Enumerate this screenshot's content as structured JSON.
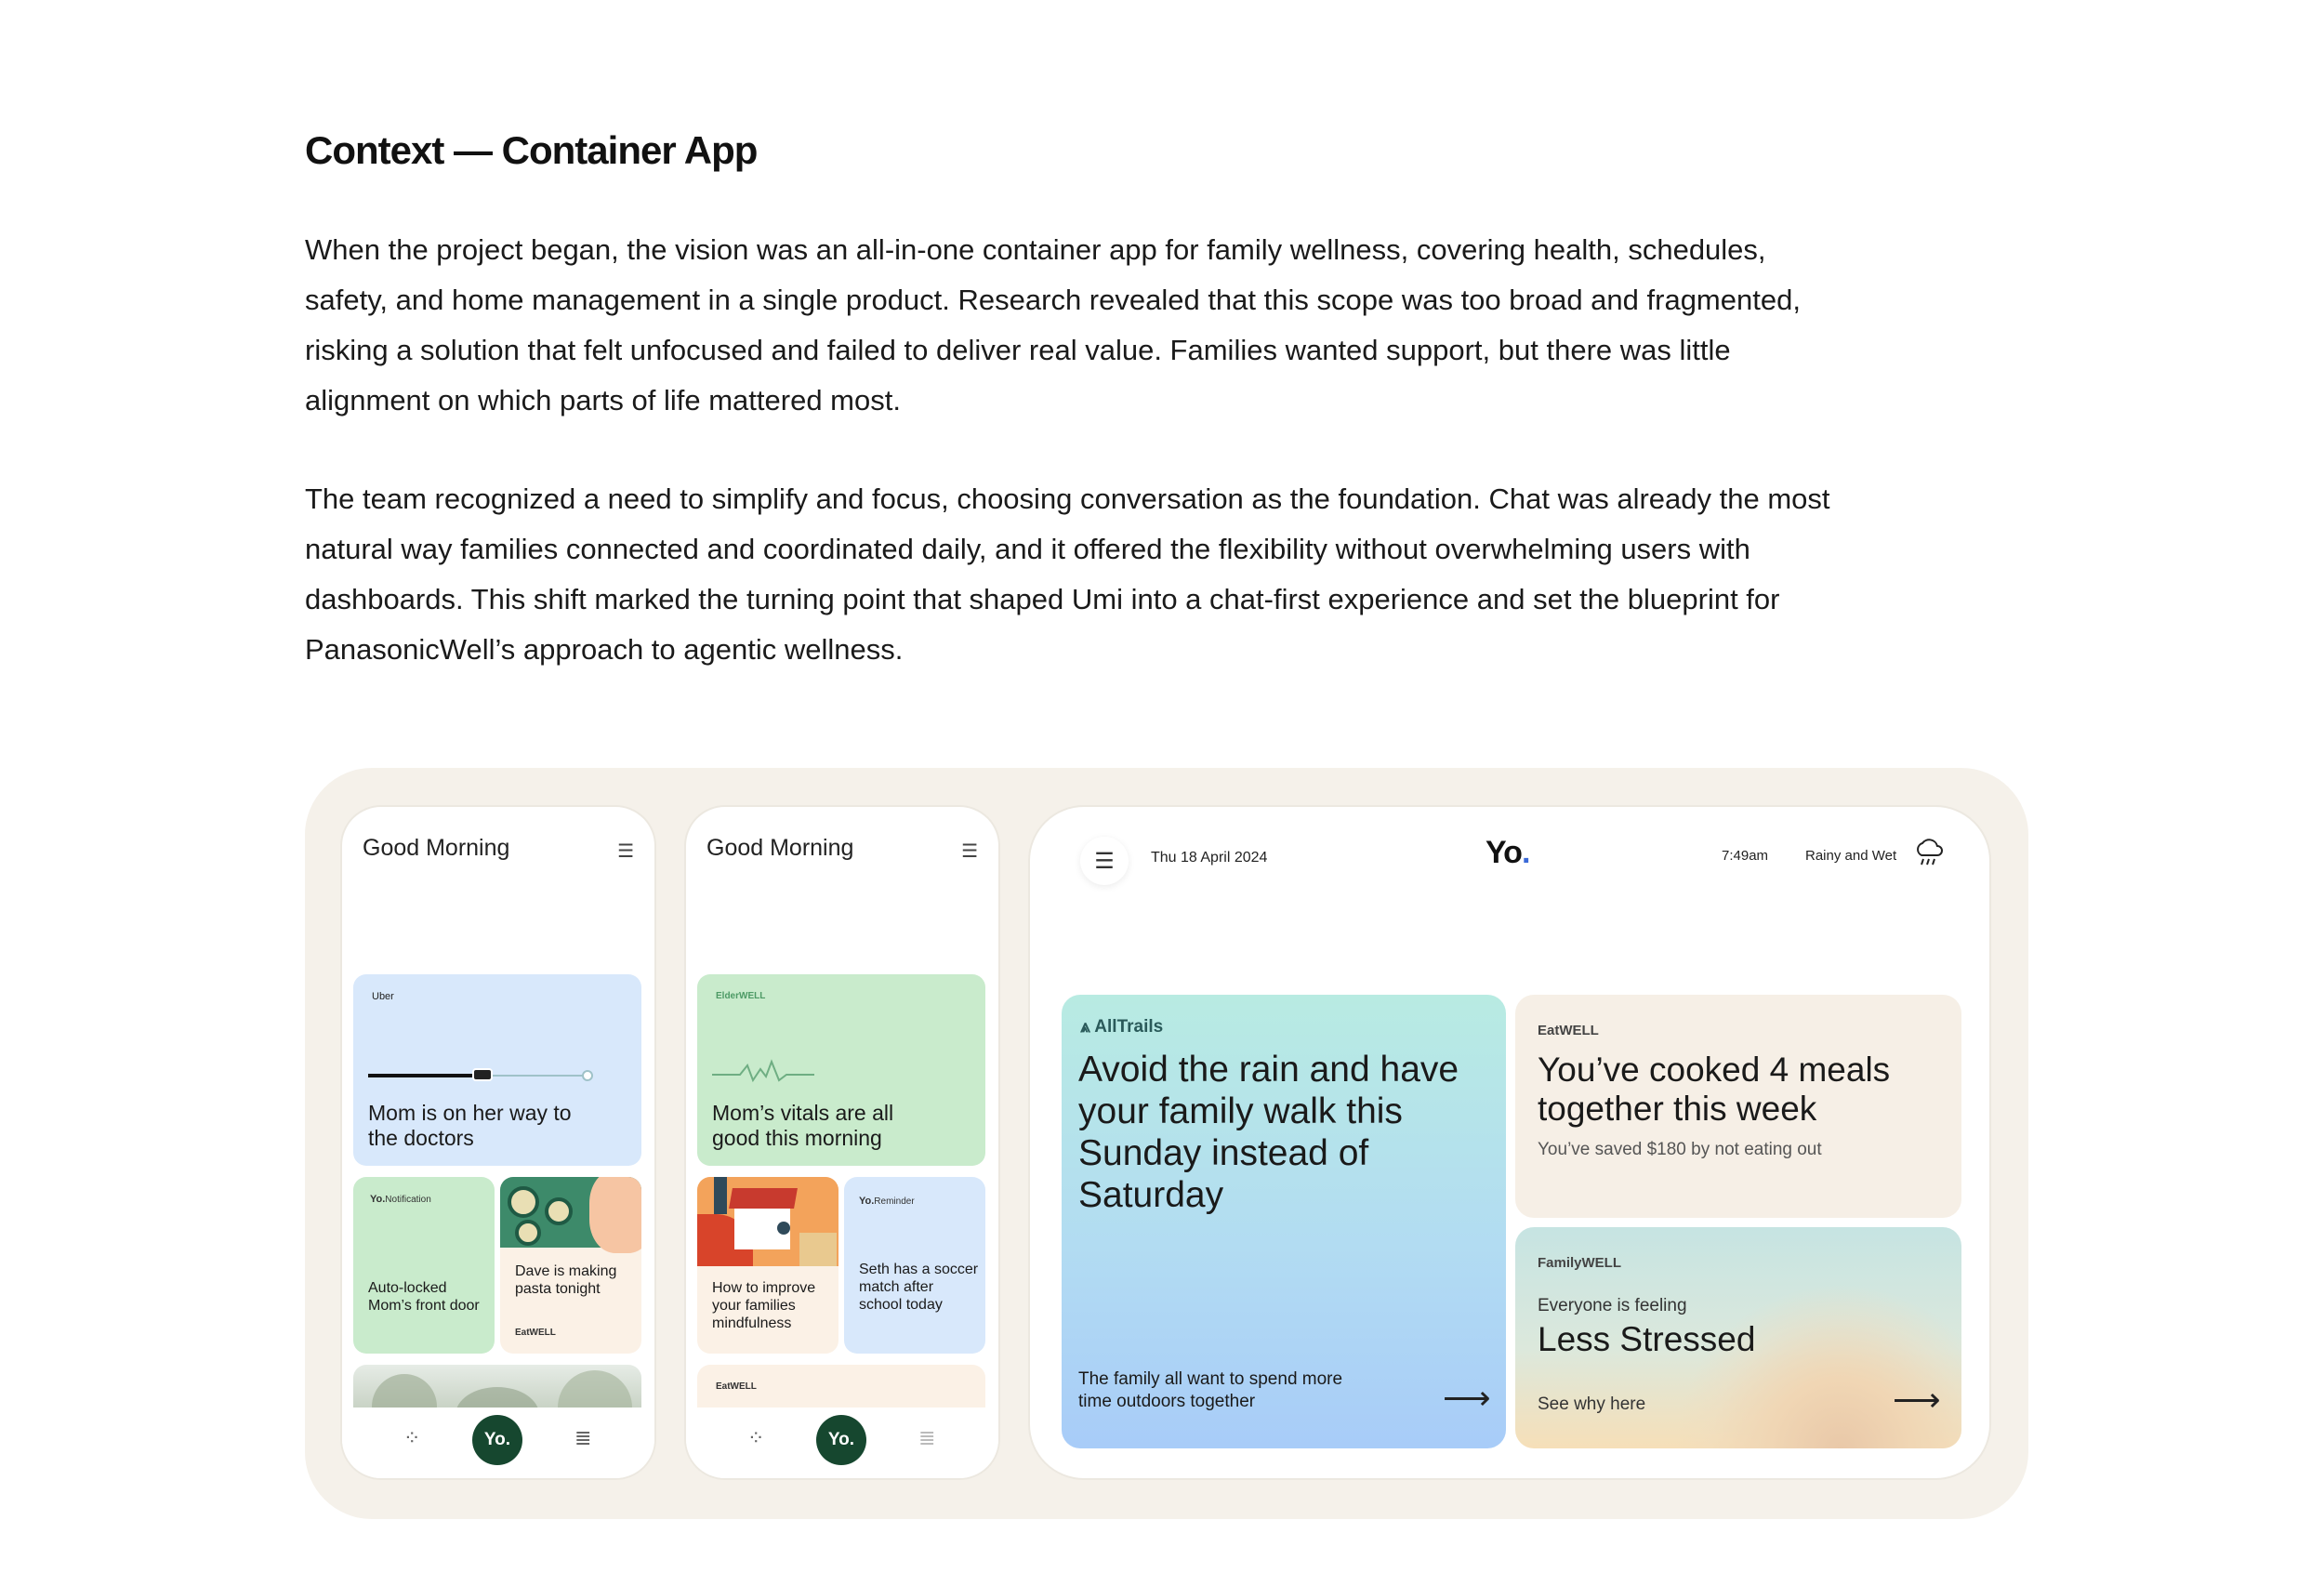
{
  "heading": "Context  — Container App",
  "paragraphs": [
    "When the project began, the vision was an all-in-one container app for family wellness, covering health, schedules, safety, and home management in a single product. Research revealed that this scope was too broad and fragmented, risking a solution that felt unfocused and failed to deliver real value. Families wanted support, but there was little alignment on which parts of life mattered most.",
    "The team recognized a need to simplify and focus, choosing conversation as the foundation. Chat was already the most natural way families connected and coordinated daily, and it offered the flexibility without overwhelming users with dashboards. This shift marked the turning point that shaped Umi into a chat-first experience and set the blueprint for PanasonicWell’s approach to agentic wellness."
  ],
  "phone1": {
    "greeting": "Good Morning",
    "menu_icon": "hamburger-icon",
    "uber_card": {
      "brand": "Uber",
      "text": "Mom is on her way to the doctors",
      "progress": 0.5,
      "color": "#d8e8fb"
    },
    "notify_card": {
      "brand": "Yo.",
      "tag": "Notification",
      "text": "Auto-locked Mom’s front door",
      "color": "#c9ebcc"
    },
    "pasta_card": {
      "text": "Dave is making pasta tonight",
      "brand": "EatWELL",
      "color": "#fbf1e6"
    },
    "nav": {
      "left_icon": "grid-icon",
      "center": "Yo.",
      "right_icon": "list-icon"
    }
  },
  "phone2": {
    "greeting": "Good Morning",
    "menu_icon": "hamburger-icon",
    "elder_card": {
      "brand": "ElderWELL",
      "text": "Mom’s vitals are all good this morning",
      "color": "#c9ebcc"
    },
    "mind_card": {
      "text": "How to improve your families mindfulness",
      "color": "#fbf1e6"
    },
    "reminder_card": {
      "brand": "Yo.",
      "tag": "Reminder",
      "text": "Seth has a soccer match after school today",
      "color": "#d8e8fb"
    },
    "eat_card": {
      "brand": "EatWELL",
      "color": "#fbf1e6"
    },
    "nav": {
      "left_icon": "grid-icon",
      "center": "Yo.",
      "right_icon": "list-icon"
    }
  },
  "tablet": {
    "menu_icon": "hamburger-icon",
    "date": "Thu 18 April 2024",
    "logo": "Yo",
    "logo_dot": ".",
    "time": "7:49am",
    "weather": "Rainy and Wet",
    "weather_icon": "rain-cloud-icon",
    "alltrails": {
      "brand": "AllTrails",
      "headline": "Avoid the rain and have your family walk this Sunday instead of Saturday",
      "sub": "The family all want to spend more time outdoors together",
      "arrow": "⟶"
    },
    "eatwell": {
      "brand": "EatWELL",
      "headline": "You’ve cooked 4 meals together this week",
      "sub": "You’ve saved $180 by not eating out"
    },
    "familywell": {
      "brand": "FamilyWELL",
      "kicker": "Everyone is feeling",
      "headline": "Less Stressed",
      "link": "See why here",
      "arrow": "⟶"
    }
  }
}
